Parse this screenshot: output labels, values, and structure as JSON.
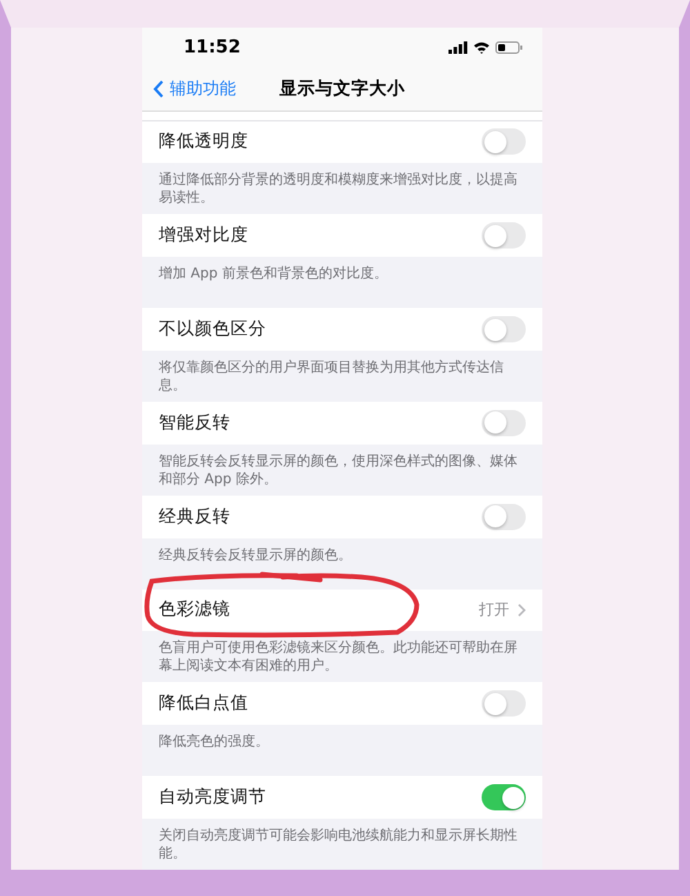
{
  "status_bar": {
    "time": "11:52"
  },
  "nav": {
    "back": "辅助功能",
    "title": "显示与文字大小"
  },
  "items": [
    {
      "kind": "toggle",
      "title": "降低透明度",
      "on": false,
      "description": "通过降低部分背景的透明度和模糊度来增强对比度，以提高易读性。"
    },
    {
      "kind": "toggle",
      "title": "增强对比度",
      "on": false,
      "description": "增加 App 前景色和背景色的对比度。"
    },
    {
      "kind": "toggle",
      "title": "不以颜色区分",
      "on": false,
      "description": "将仅靠颜色区分的用户界面项目替换为用其他方式传达信息。"
    },
    {
      "kind": "toggle",
      "title": "智能反转",
      "on": false,
      "description": "智能反转会反转显示屏的颜色，使用深色样式的图像、媒体和部分 App 除外。"
    },
    {
      "kind": "toggle",
      "title": "经典反转",
      "on": false,
      "description": "经典反转会反转显示屏的颜色。"
    },
    {
      "kind": "link",
      "title": "色彩滤镜",
      "value": "打开",
      "description": "色盲用户可使用色彩滤镜来区分颜色。此功能还可帮助在屏幕上阅读文本有困难的用户。"
    },
    {
      "kind": "toggle",
      "title": "降低白点值",
      "on": false,
      "description": "降低亮色的强度。"
    },
    {
      "kind": "toggle",
      "title": "自动亮度调节",
      "on": true,
      "description": "关闭自动亮度调节可能会影响电池续航能力和显示屏长期性能。"
    }
  ]
}
